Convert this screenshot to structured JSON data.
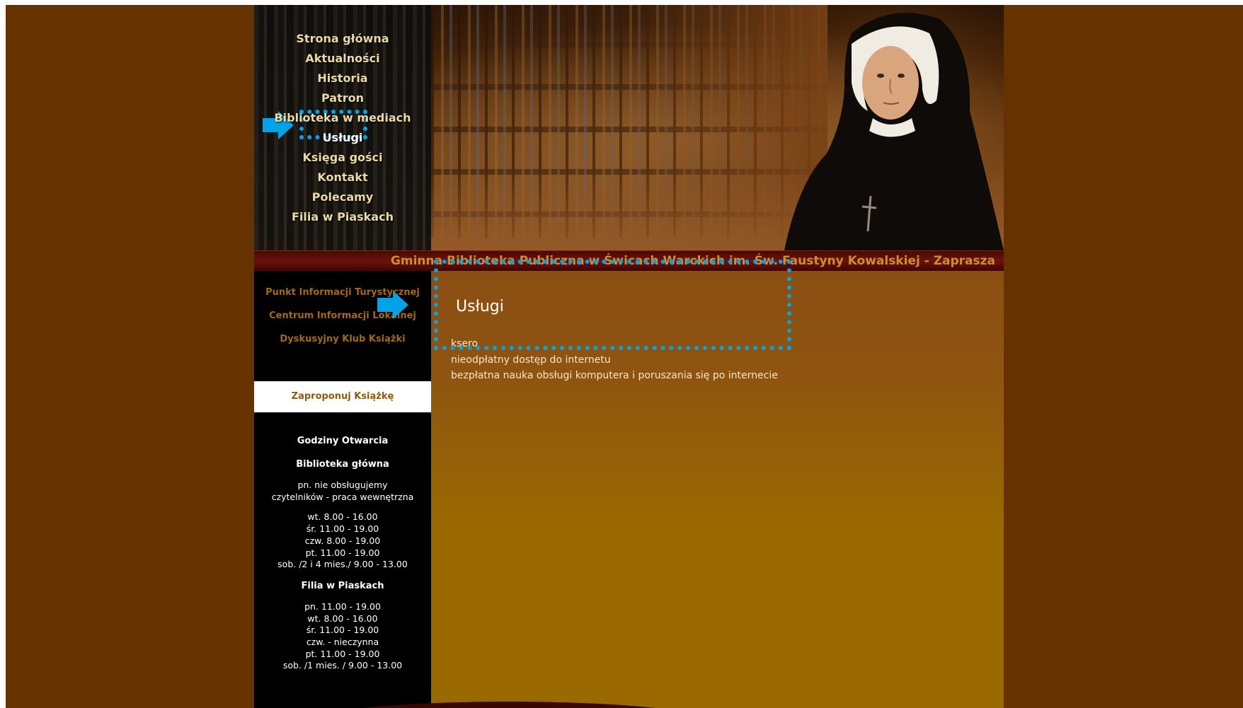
{
  "nav": {
    "items": [
      {
        "label": "Strona główna"
      },
      {
        "label": "Aktualności"
      },
      {
        "label": "Historia"
      },
      {
        "label": "Patron"
      },
      {
        "label": "Biblioteka w mediach"
      },
      {
        "label": "Usługi"
      },
      {
        "label": "Księga gości"
      },
      {
        "label": "Kontakt"
      },
      {
        "label": "Polecamy"
      },
      {
        "label": "Filia w Piaskach"
      }
    ],
    "active_index": 5
  },
  "banner": {
    "title": "Gminna Biblioteka Publiczna w Świcach Warckich im. Św. Faustyny Kowalskiej - Zaprasza"
  },
  "sidebar": {
    "links": [
      {
        "label": "Punkt Informacji Turystycznej"
      },
      {
        "label": "Centrum Informacji Lokalnej"
      },
      {
        "label": "Dyskusyjny Klub Książki"
      }
    ],
    "suggest_label": "Zaproponuj Książkę",
    "hours": {
      "title": "Godziny Otwarcia",
      "main_library": {
        "title": "Biblioteka główna",
        "note_line1": "pn. nie obsługujemy",
        "note_line2": "czytelników - praca wewnętrzna",
        "lines": [
          "wt. 8.00 - 16.00",
          "śr. 11.00 - 19.00",
          "czw. 8.00 - 19.00",
          "pt. 11.00 - 19.00",
          "sob. /2 i 4 mies./ 9.00 - 13.00"
        ]
      },
      "branch": {
        "title": "Filia w Piaskach",
        "lines": [
          "pn. 11.00 - 19.00",
          "wt. 8.00 - 16.00",
          "śr. 11.00 - 19.00",
          "czw. - nieczynna",
          "pt. 11.00 - 19.00",
          "sob. /1 mies. / 9.00 - 13.00"
        ]
      }
    }
  },
  "content": {
    "title": "Usługi",
    "services": [
      "ksero",
      "nieodpłatny dostęp do internetu",
      "bezpłatna nauka obsługi komputera i poruszania się po internecie"
    ]
  },
  "colors": {
    "page_bg": "#663300",
    "annotation": "#00a3e8",
    "title_text": "#c98f33"
  }
}
